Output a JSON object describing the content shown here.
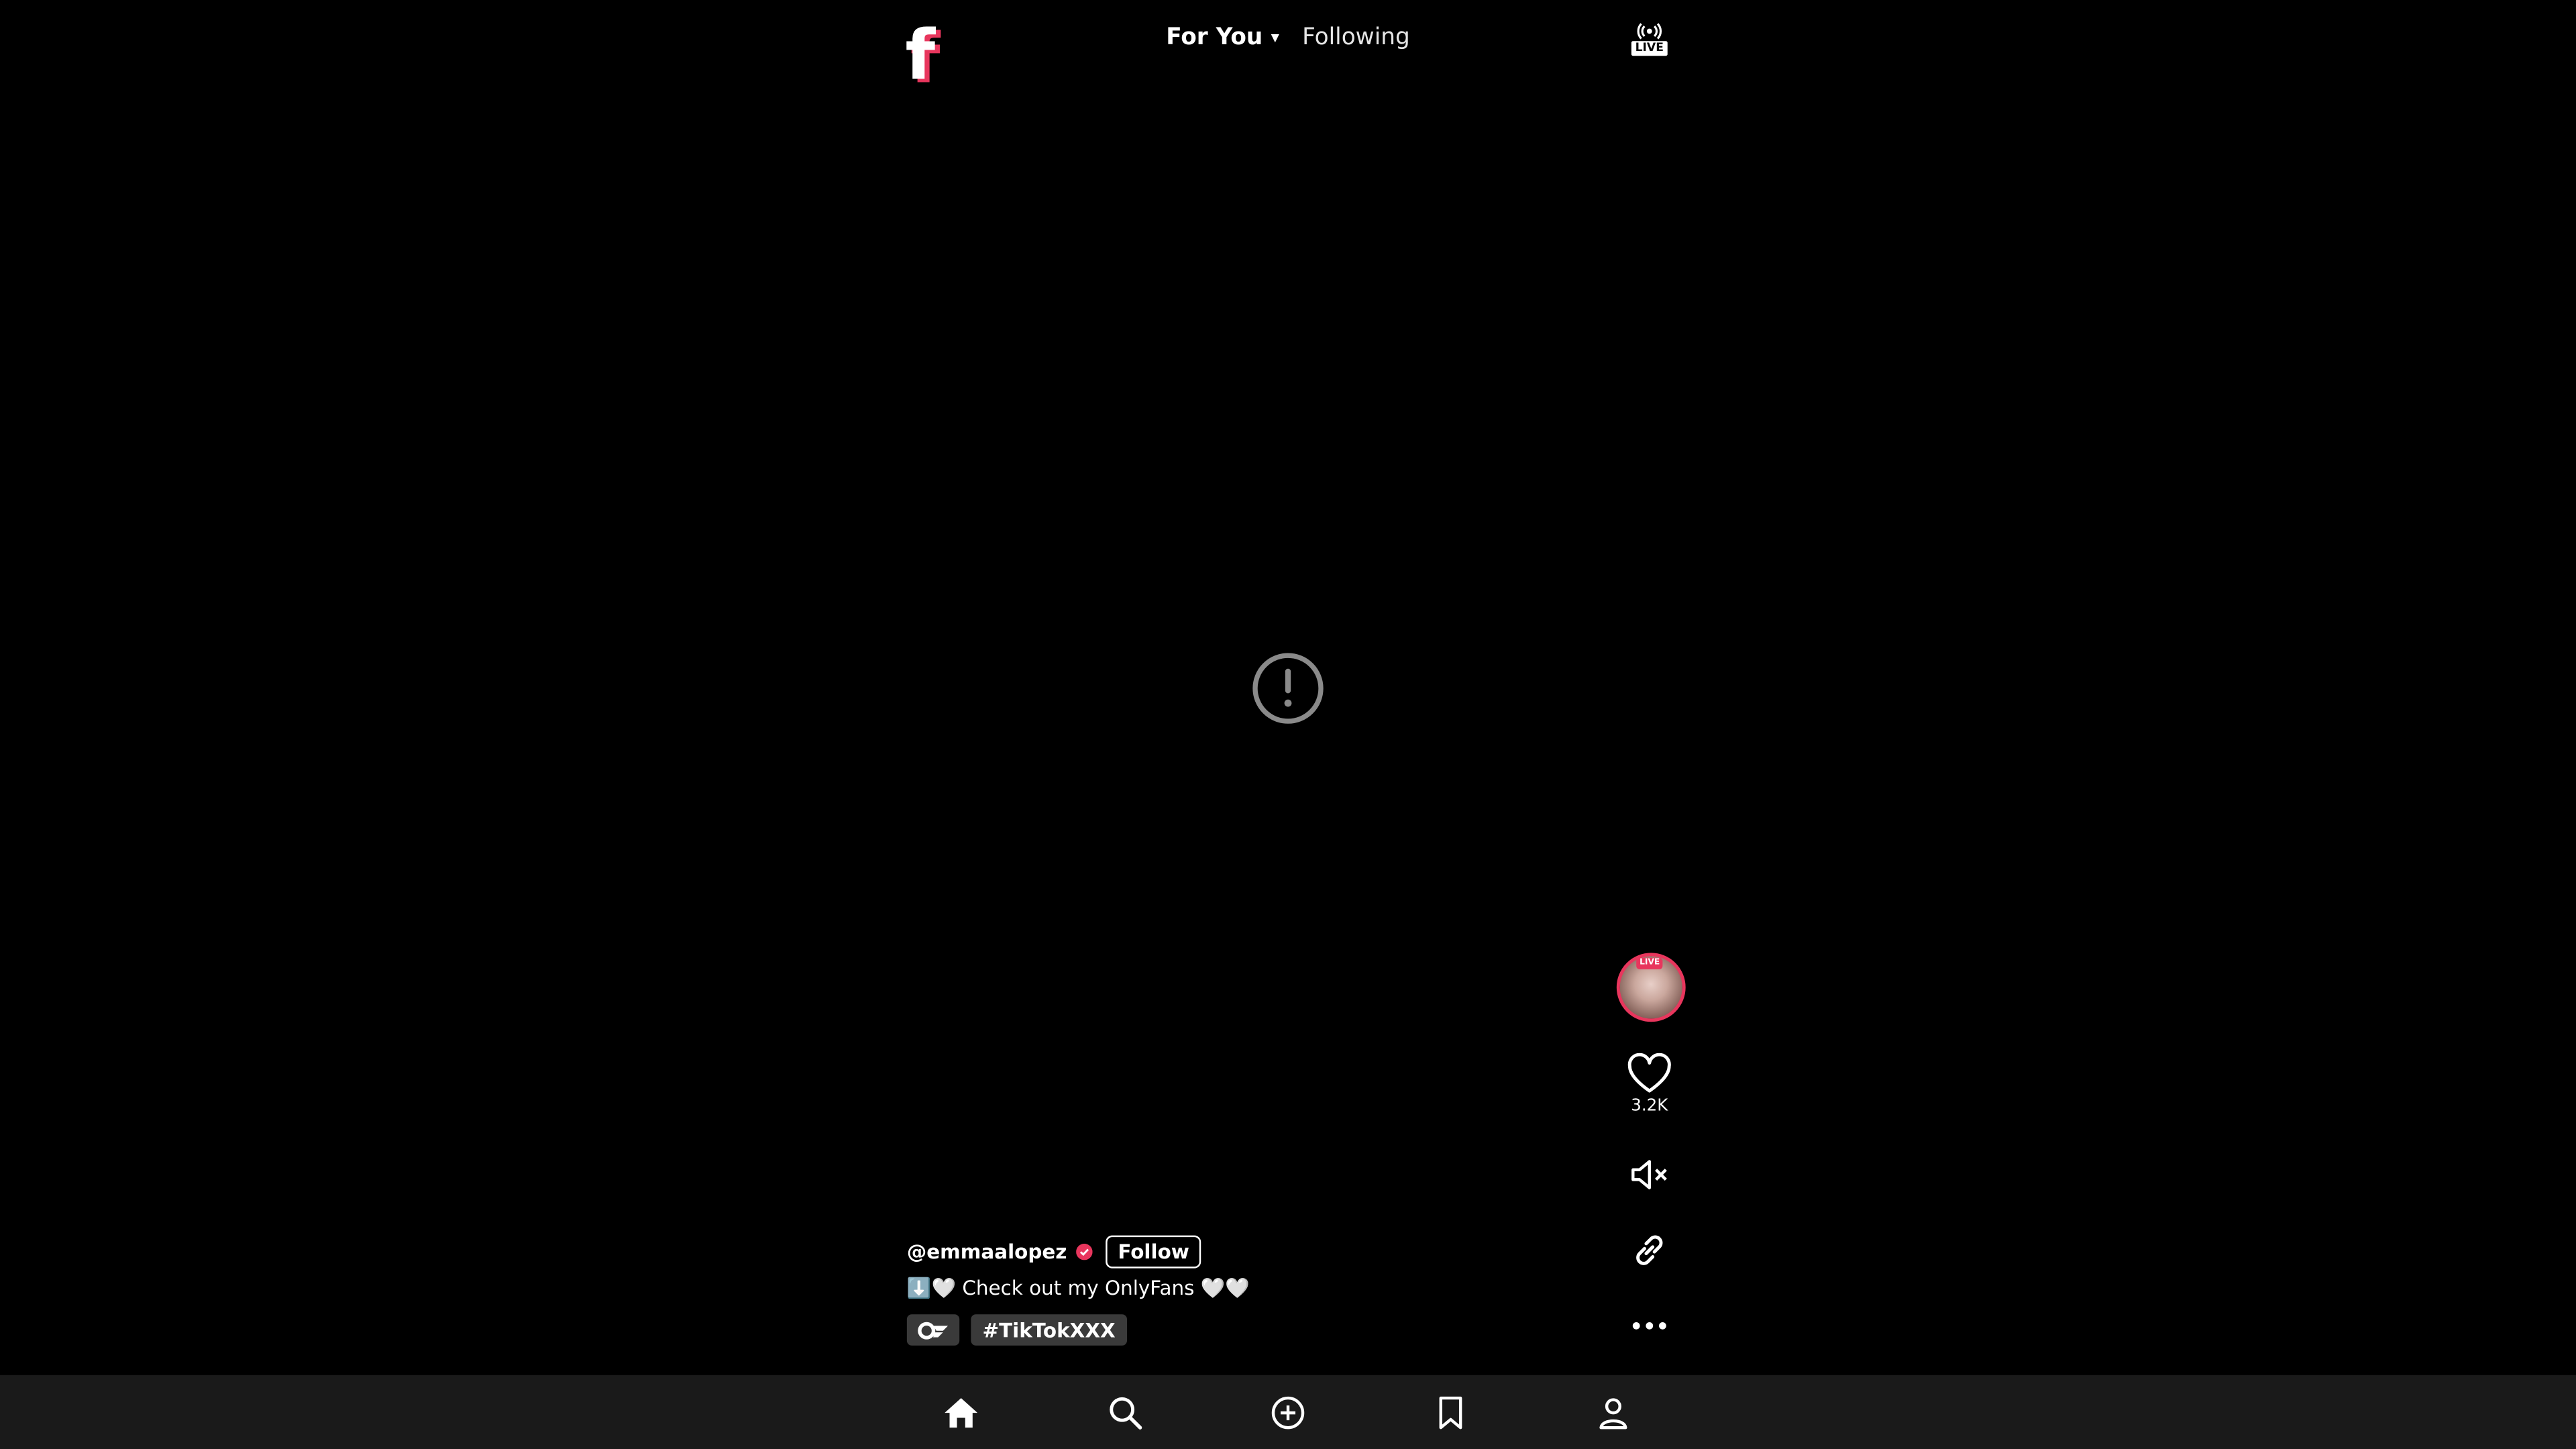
{
  "header": {
    "tabs": [
      {
        "label": "For You",
        "caret": "▾",
        "active": true
      },
      {
        "label": "Following",
        "active": false
      }
    ],
    "logo_letter": "f",
    "live_label": "LIVE"
  },
  "video": {
    "status_icon": "exclamation-circle-icon"
  },
  "actions": {
    "avatar_live_badge": "LIVE",
    "like_count": "3.2K"
  },
  "post": {
    "username": "@emmaalopez",
    "follow_label": "Follow",
    "caption": "⬇️🤍 Check out my OnlyFans 🤍🤍",
    "hashtag": "#TikTokXXX"
  },
  "nav": {
    "items": [
      "home-icon",
      "search-icon",
      "create-icon",
      "bookmark-icon",
      "profile-icon"
    ]
  },
  "colors": {
    "background": "#000000",
    "accent": "#e8365d",
    "nav_background": "#1a1a1a",
    "chip_background": "#3a3a3a"
  }
}
